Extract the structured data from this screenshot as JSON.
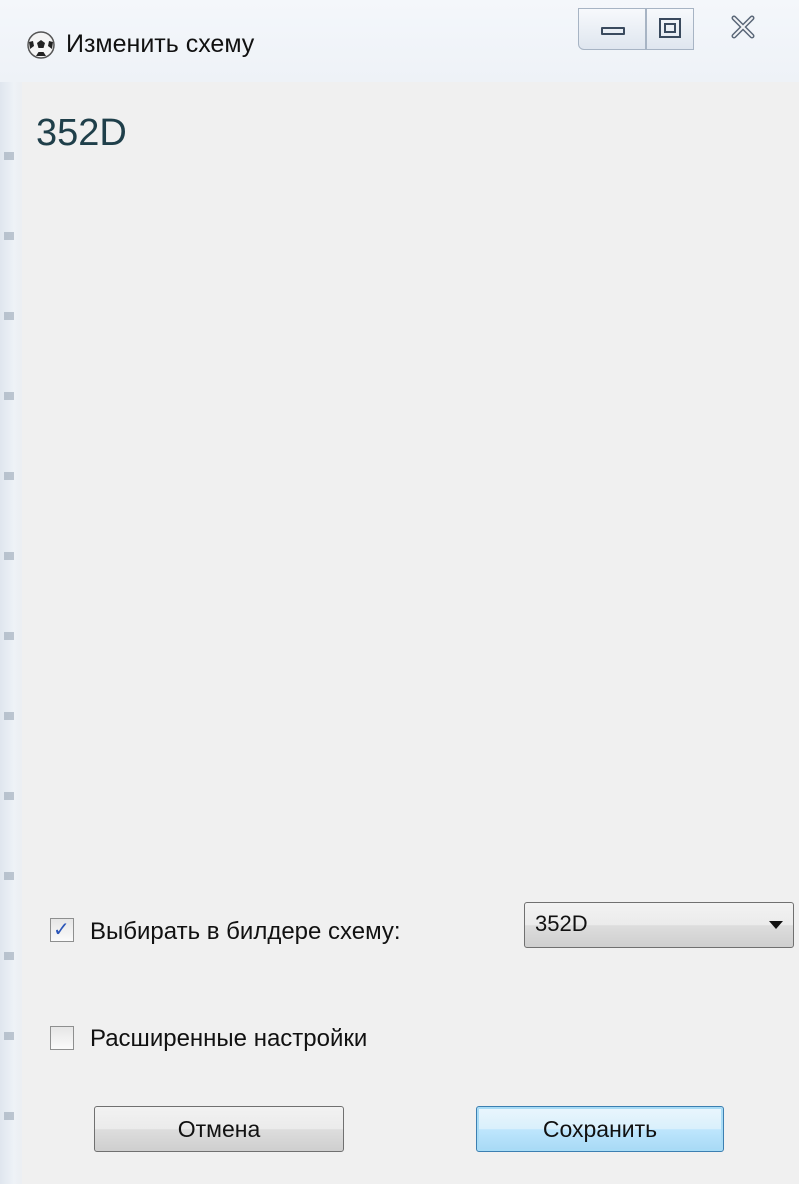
{
  "window": {
    "title": "Изменить схему",
    "icon": "football-icon"
  },
  "scheme": {
    "name": "352D"
  },
  "options": {
    "select_in_builder": {
      "label": "Выбирать в билдере схему:",
      "checked": true
    },
    "scheme_combo": {
      "selected": "352D"
    },
    "advanced_settings": {
      "label": "Расширенные настройки",
      "checked": false
    }
  },
  "buttons": {
    "cancel_label": "Отмена",
    "save_label": "Сохранить"
  },
  "colors": {
    "scheme_title": "#1f3f4a",
    "checkbox_mark": "#2a55b8",
    "default_button_border": "#3c7fb1"
  }
}
